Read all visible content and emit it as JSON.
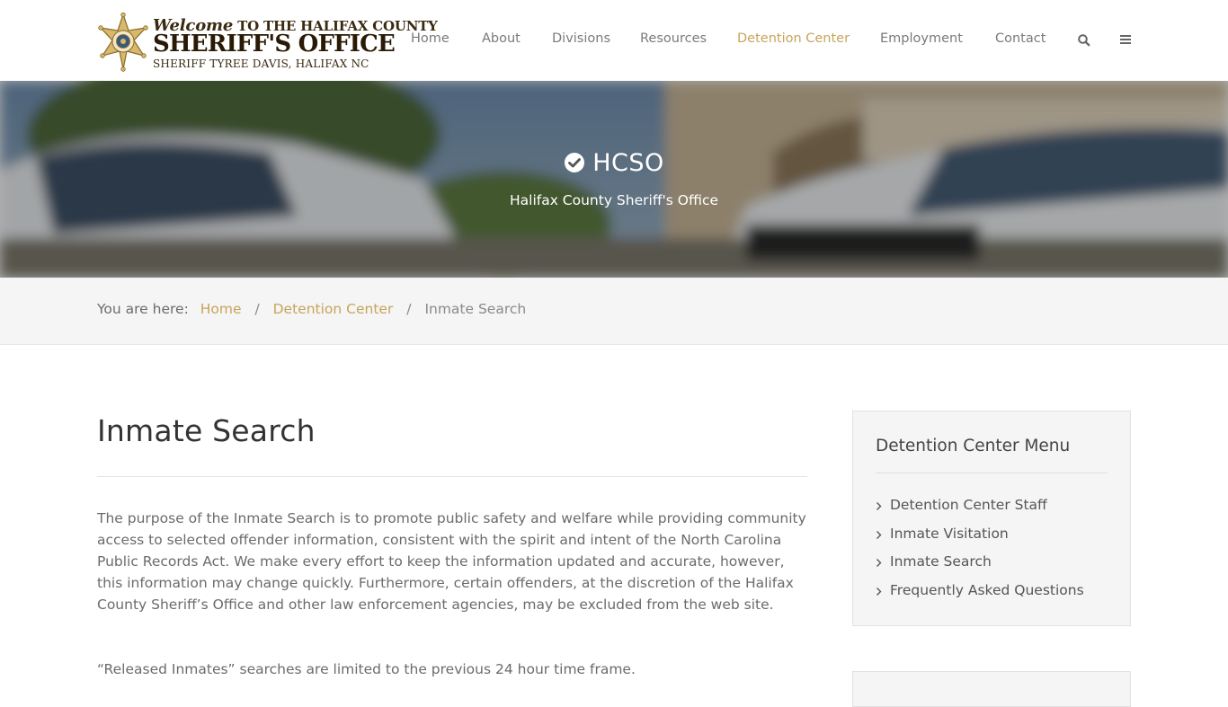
{
  "header": {
    "logo": {
      "line1_script": "Welcome",
      "line1_rest": "TO THE HALIFAX COUNTY",
      "line2": "SHERIFF'S OFFICE",
      "line3": "SHERIFF TYREE DAVIS, HALIFAX NC"
    },
    "nav": [
      {
        "label": "Home",
        "active": false
      },
      {
        "label": "About",
        "active": false
      },
      {
        "label": "Divisions",
        "active": false
      },
      {
        "label": "Resources",
        "active": false
      },
      {
        "label": "Detention Center",
        "active": true
      },
      {
        "label": "Employment",
        "active": false
      },
      {
        "label": "Contact",
        "active": false
      }
    ],
    "icons": [
      "search-icon",
      "menu-icon"
    ]
  },
  "hero": {
    "title": "HCSO",
    "subtitle": "Halifax County Sheriff's Office",
    "icon": "check-circle-icon"
  },
  "breadcrumb": {
    "lead": "You are here:",
    "items": [
      "Home",
      "Detention Center"
    ],
    "separator": "/",
    "current": "Inmate Search"
  },
  "main": {
    "title": "Inmate Search",
    "paragraphs": [
      "The purpose of the Inmate Search is to promote public safety and welfare while providing community access to selected offender information, consistent with the spirit and intent of the North Carolina Public Records Act. We make every effort to keep the information updated and accurate, however, this information may change quickly. Furthermore, certain offenders, at the discretion of the Halifax County Sheriff’s Office and other law enforcement agencies, may be excluded from the web site.",
      "“Released Inmates” searches are limited to the previous 24 hour time frame."
    ]
  },
  "sidebar": {
    "title": "Detention Center Menu",
    "items": [
      "Detention Center Staff",
      "Inmate Visitation",
      "Inmate Search",
      "Frequently Asked Questions"
    ]
  },
  "colors": {
    "accent": "#c8a45a",
    "nav_text": "#7a7a7a",
    "body_text": "#6b6b6b",
    "panel_bg": "#f5f5f5"
  }
}
